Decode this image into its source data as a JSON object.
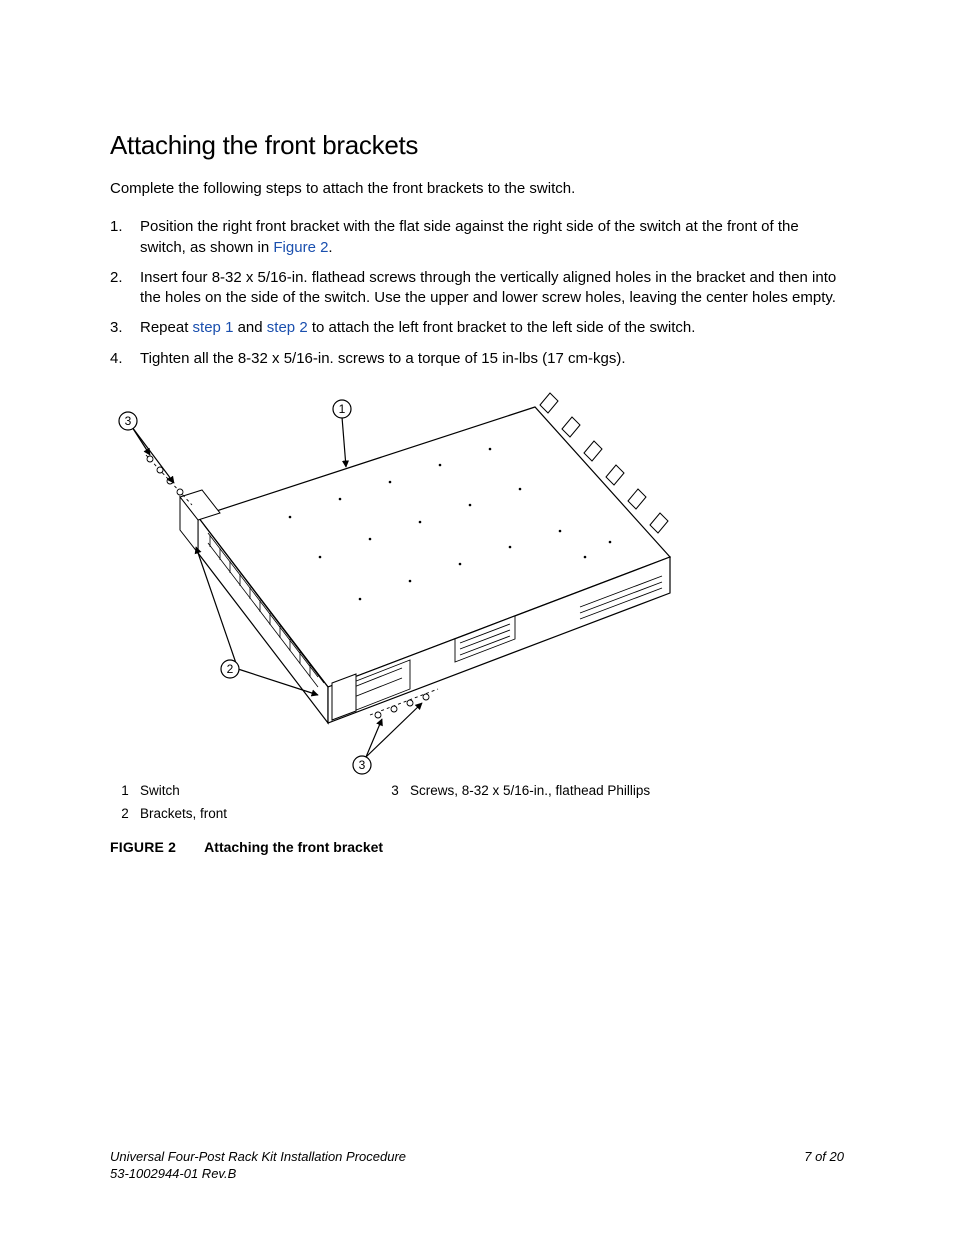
{
  "heading": "Attaching the front brackets",
  "intro": "Complete the following steps to attach the front brackets to the switch.",
  "steps": {
    "s1a": "Position the right front bracket with the flat side against the right side of the switch at the front of the switch, as shown in ",
    "s1_link": "Figure 2",
    "s1b": ".",
    "s2": "Insert four 8-32 x 5/16-in. flathead screws through the vertically aligned holes in the bracket and then into the holes on the side of the switch. Use the upper and lower screw holes, leaving the center holes empty.",
    "s3a": "Repeat ",
    "s3_link1": "step 1",
    "s3b": " and ",
    "s3_link2": "step 2",
    "s3c": " to attach the left front bracket to the left side of the switch.",
    "s4": "Tighten all the 8-32 x 5/16-in. screws to a torque of 15 in-lbs (17 cm-kgs)."
  },
  "callouts": {
    "c1": "1",
    "c2": "2",
    "c3": "3"
  },
  "legend": {
    "n1": "1",
    "t1": "Switch",
    "n2": "2",
    "t2": "Brackets, front",
    "n3": "3",
    "t3": "Screws, 8-32 x 5/16-in., flathead Phillips"
  },
  "figcap": {
    "label": "FIGURE 2",
    "text": "Attaching the front bracket"
  },
  "footer": {
    "title": "Universal Four-Post Rack Kit Installation Procedure",
    "docnum": "53-1002944-01 Rev.B",
    "page": "7 of 20"
  }
}
